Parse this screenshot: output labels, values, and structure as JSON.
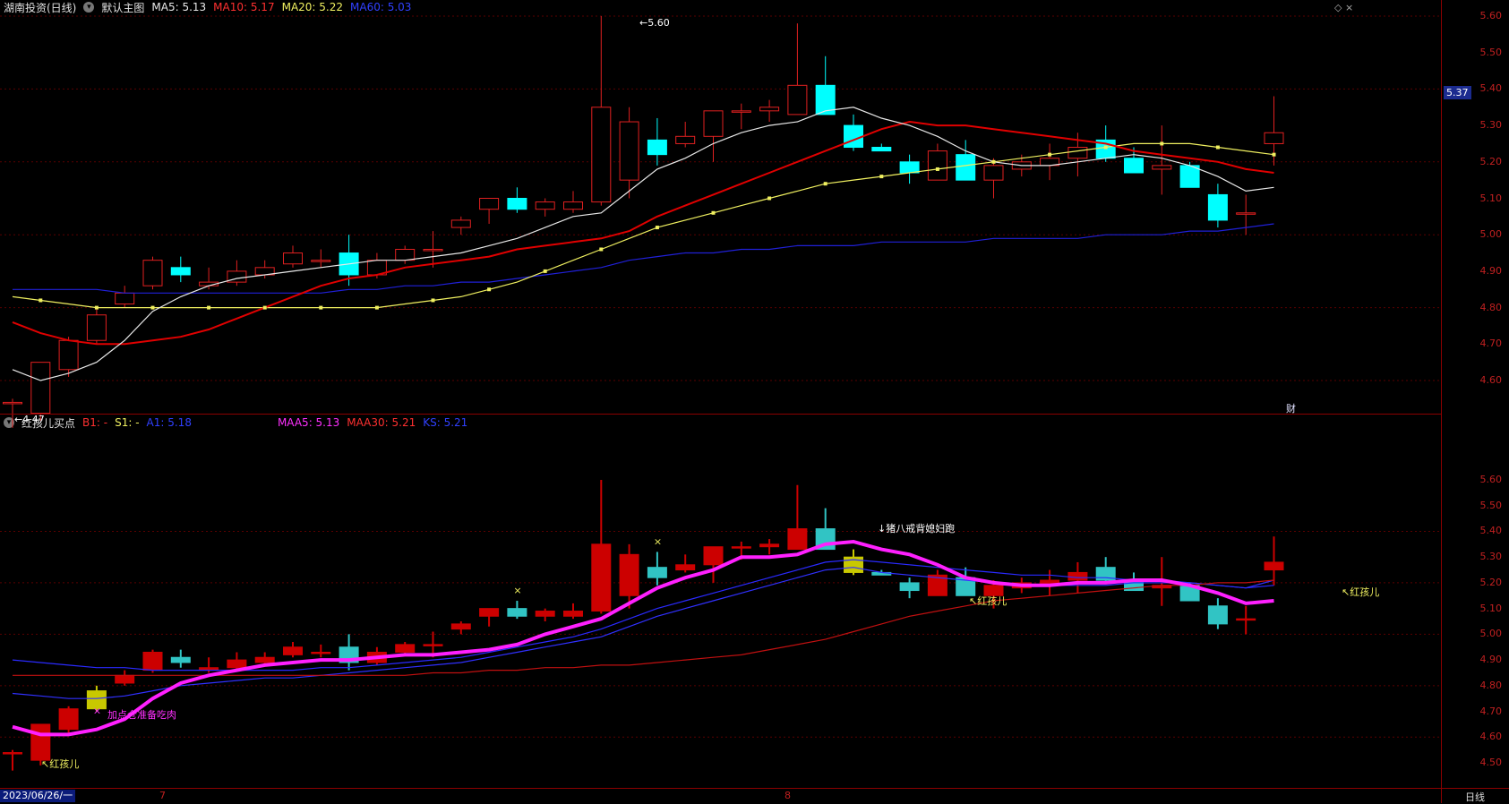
{
  "colors": {
    "up": "#e02020",
    "up_fill": "#cc0000",
    "down": "#00ffff",
    "down_fill": "#31c4c4",
    "ma5": "#e8e8e8",
    "ma10": "#e00000",
    "ma20": "#f0f060",
    "ma60": "#2020d8",
    "maa5": "#ff20ff",
    "maa30": "#c01010",
    "ks": "#3030ff",
    "yellow": "#c8c800"
  },
  "main": {
    "title": "湖南投资(日线)",
    "template": "默认主图",
    "ma5": "MA5: 5.13",
    "ma10": "MA10: 5.17",
    "ma20": "MA20: 5.22",
    "ma60": "MA60: 5.03",
    "high_label": "5.60",
    "low_label": "4.47",
    "last_price": "5.37",
    "fin_marker": "财"
  },
  "sub": {
    "title": "红孩儿买点",
    "b1": "B1: -",
    "s1": "S1: -",
    "a1": "A1: 5.18",
    "maa5": "MAA5: 5.13",
    "maa30": "MAA30: 5.21",
    "ks": "KS: 5.21",
    "ann_buy": "加点仓准备吃肉",
    "ann_sell": "↓猪八戒背媳妇跑",
    "ann_red1": "红孩儿",
    "ann_red2": "红孩儿",
    "ann_red3": "红孩儿"
  },
  "axis_main": [
    "5.60",
    "5.50",
    "5.40",
    "5.30",
    "5.20",
    "5.10",
    "5.00",
    "4.90",
    "4.80",
    "4.70",
    "4.60"
  ],
  "axis_sub": [
    "5.60",
    "5.50",
    "5.40",
    "5.30",
    "5.20",
    "5.10",
    "5.00",
    "4.90",
    "4.80",
    "4.70",
    "4.60",
    "4.50"
  ],
  "bottom": {
    "date": "2023/06/26/一",
    "month7": "7",
    "month8": "8",
    "period": "日线"
  },
  "chart_data": {
    "type": "candlestick",
    "ohlc": [
      [
        4.54,
        4.55,
        4.47,
        4.54
      ],
      [
        4.51,
        4.65,
        4.49,
        4.65
      ],
      [
        4.63,
        4.72,
        4.61,
        4.71
      ],
      [
        4.71,
        4.8,
        4.7,
        4.78
      ],
      [
        4.81,
        4.86,
        4.8,
        4.84
      ],
      [
        4.86,
        4.94,
        4.85,
        4.93
      ],
      [
        4.91,
        4.94,
        4.87,
        4.89
      ],
      [
        4.86,
        4.91,
        4.85,
        4.87
      ],
      [
        4.87,
        4.93,
        4.86,
        4.9
      ],
      [
        4.89,
        4.93,
        4.88,
        4.91
      ],
      [
        4.92,
        4.97,
        4.91,
        4.95
      ],
      [
        4.93,
        4.96,
        4.91,
        4.93
      ],
      [
        4.95,
        5.0,
        4.86,
        4.89
      ],
      [
        4.89,
        4.95,
        4.88,
        4.93
      ],
      [
        4.93,
        4.97,
        4.92,
        4.96
      ],
      [
        4.96,
        5.01,
        4.91,
        4.96
      ],
      [
        5.02,
        5.05,
        5.0,
        5.04
      ],
      [
        5.07,
        5.1,
        5.03,
        5.1
      ],
      [
        5.1,
        5.13,
        5.06,
        5.07
      ],
      [
        5.07,
        5.1,
        5.05,
        5.09
      ],
      [
        5.07,
        5.12,
        5.06,
        5.09
      ],
      [
        5.09,
        5.6,
        5.08,
        5.35
      ],
      [
        5.15,
        5.35,
        5.1,
        5.31
      ],
      [
        5.26,
        5.32,
        5.19,
        5.22
      ],
      [
        5.25,
        5.31,
        5.24,
        5.27
      ],
      [
        5.27,
        5.34,
        5.2,
        5.34
      ],
      [
        5.34,
        5.36,
        5.29,
        5.34
      ],
      [
        5.34,
        5.37,
        5.31,
        5.35
      ],
      [
        5.33,
        5.58,
        5.33,
        5.41
      ],
      [
        5.41,
        5.49,
        5.34,
        5.33
      ],
      [
        5.3,
        5.33,
        5.23,
        5.24
      ],
      [
        5.24,
        5.25,
        5.23,
        5.23
      ],
      [
        5.2,
        5.22,
        5.14,
        5.17
      ],
      [
        5.15,
        5.25,
        5.15,
        5.23
      ],
      [
        5.22,
        5.26,
        5.15,
        5.15
      ],
      [
        5.15,
        5.21,
        5.1,
        5.19
      ],
      [
        5.18,
        5.22,
        5.16,
        5.2
      ],
      [
        5.19,
        5.25,
        5.15,
        5.21
      ],
      [
        5.21,
        5.28,
        5.16,
        5.24
      ],
      [
        5.26,
        5.3,
        5.2,
        5.21
      ],
      [
        5.21,
        5.24,
        5.17,
        5.17
      ],
      [
        5.18,
        5.3,
        5.11,
        5.19
      ],
      [
        5.19,
        5.2,
        5.13,
        5.13
      ],
      [
        5.11,
        5.14,
        5.02,
        5.04
      ],
      [
        5.06,
        5.11,
        5.0,
        5.06
      ],
      [
        5.25,
        5.38,
        5.19,
        5.28
      ]
    ],
    "ma5": [
      4.63,
      4.6,
      4.62,
      4.65,
      4.71,
      4.79,
      4.83,
      4.86,
      4.88,
      4.89,
      4.9,
      4.91,
      4.92,
      4.93,
      4.93,
      4.94,
      4.95,
      4.97,
      4.99,
      5.02,
      5.05,
      5.06,
      5.12,
      5.18,
      5.21,
      5.25,
      5.28,
      5.3,
      5.31,
      5.34,
      5.35,
      5.32,
      5.3,
      5.27,
      5.23,
      5.2,
      5.19,
      5.19,
      5.2,
      5.21,
      5.22,
      5.21,
      5.19,
      5.16,
      5.12,
      5.13
    ],
    "ma10": [
      4.76,
      4.73,
      4.71,
      4.7,
      4.7,
      4.71,
      4.72,
      4.74,
      4.77,
      4.8,
      4.83,
      4.86,
      4.88,
      4.89,
      4.91,
      4.92,
      4.93,
      4.94,
      4.96,
      4.97,
      4.98,
      4.99,
      5.01,
      5.05,
      5.08,
      5.11,
      5.14,
      5.17,
      5.2,
      5.23,
      5.26,
      5.29,
      5.31,
      5.3,
      5.3,
      5.29,
      5.28,
      5.27,
      5.26,
      5.25,
      5.23,
      5.22,
      5.21,
      5.2,
      5.18,
      5.17
    ],
    "ma20": [
      4.83,
      4.82,
      4.81,
      4.8,
      4.8,
      4.8,
      4.8,
      4.8,
      4.8,
      4.8,
      4.8,
      4.8,
      4.8,
      4.8,
      4.81,
      4.82,
      4.83,
      4.85,
      4.87,
      4.9,
      4.93,
      4.96,
      4.99,
      5.02,
      5.04,
      5.06,
      5.08,
      5.1,
      5.12,
      5.14,
      5.15,
      5.16,
      5.17,
      5.18,
      5.19,
      5.2,
      5.21,
      5.22,
      5.23,
      5.24,
      5.25,
      5.25,
      5.25,
      5.24,
      5.23,
      5.22
    ],
    "ma60": [
      4.85,
      4.85,
      4.85,
      4.85,
      4.84,
      4.84,
      4.84,
      4.84,
      4.84,
      4.84,
      4.84,
      4.84,
      4.85,
      4.85,
      4.86,
      4.86,
      4.87,
      4.87,
      4.88,
      4.89,
      4.9,
      4.91,
      4.93,
      4.94,
      4.95,
      4.95,
      4.96,
      4.96,
      4.97,
      4.97,
      4.97,
      4.98,
      4.98,
      4.98,
      4.98,
      4.99,
      4.99,
      4.99,
      4.99,
      5.0,
      5.0,
      5.0,
      5.01,
      5.01,
      5.02,
      5.03
    ],
    "maa5": [
      4.64,
      4.61,
      4.61,
      4.63,
      4.67,
      4.75,
      4.81,
      4.84,
      4.86,
      4.88,
      4.89,
      4.9,
      4.9,
      4.91,
      4.92,
      4.92,
      4.93,
      4.94,
      4.96,
      5.0,
      5.03,
      5.06,
      5.12,
      5.18,
      5.22,
      5.25,
      5.3,
      5.3,
      5.31,
      5.35,
      5.36,
      5.33,
      5.31,
      5.27,
      5.22,
      5.2,
      5.19,
      5.19,
      5.2,
      5.2,
      5.21,
      5.21,
      5.19,
      5.16,
      5.12,
      5.13
    ],
    "maa30": [
      4.84,
      4.84,
      4.84,
      4.84,
      4.84,
      4.84,
      4.84,
      4.84,
      4.84,
      4.84,
      4.84,
      4.84,
      4.84,
      4.84,
      4.84,
      4.85,
      4.85,
      4.86,
      4.86,
      4.87,
      4.87,
      4.88,
      4.88,
      4.89,
      4.9,
      4.91,
      4.92,
      4.94,
      4.96,
      4.98,
      5.01,
      5.04,
      5.07,
      5.09,
      5.11,
      5.13,
      5.14,
      5.15,
      5.16,
      5.17,
      5.18,
      5.19,
      5.19,
      5.2,
      5.2,
      5.21
    ],
    "ks": [
      4.77,
      4.76,
      4.75,
      4.75,
      4.76,
      4.78,
      4.8,
      4.81,
      4.82,
      4.83,
      4.83,
      4.84,
      4.85,
      4.86,
      4.87,
      4.88,
      4.89,
      4.91,
      4.93,
      4.95,
      4.97,
      4.99,
      5.03,
      5.07,
      5.1,
      5.13,
      5.16,
      5.19,
      5.22,
      5.25,
      5.26,
      5.24,
      5.23,
      5.22,
      5.21,
      5.2,
      5.19,
      5.19,
      5.19,
      5.19,
      5.2,
      5.2,
      5.2,
      5.19,
      5.18,
      5.21
    ],
    "ks2": [
      4.9,
      4.89,
      4.88,
      4.87,
      4.87,
      4.86,
      4.86,
      4.86,
      4.86,
      4.86,
      4.86,
      4.87,
      4.87,
      4.88,
      4.89,
      4.9,
      4.91,
      4.93,
      4.95,
      4.97,
      4.99,
      5.02,
      5.06,
      5.1,
      5.13,
      5.16,
      5.19,
      5.22,
      5.25,
      5.28,
      5.29,
      5.28,
      5.27,
      5.26,
      5.25,
      5.24,
      5.23,
      5.23,
      5.22,
      5.22,
      5.21,
      5.21,
      5.2,
      5.19,
      5.18,
      5.19
    ],
    "sub_yellow_idx": [
      3,
      30
    ],
    "ma20_markers": [
      1,
      3,
      5,
      7,
      9,
      11,
      13,
      15,
      17,
      19,
      21,
      23,
      25,
      27,
      29,
      31,
      33,
      35,
      37,
      39,
      41,
      43,
      45
    ]
  }
}
